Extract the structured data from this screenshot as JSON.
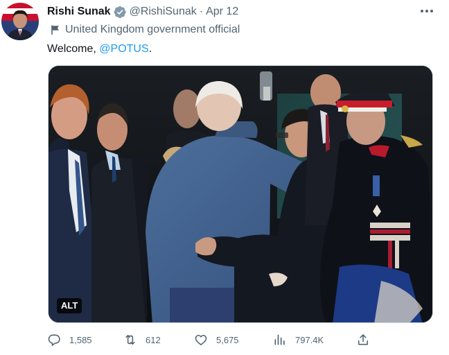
{
  "author": {
    "name": "Rishi Sunak",
    "handle": "@RishiSunak",
    "separator": "·",
    "date": "Apr 12",
    "affiliation": "United Kingdom government official"
  },
  "tweet": {
    "text_prefix": "Welcome, ",
    "mention": "@POTUS",
    "text_suffix": "."
  },
  "media": {
    "alt_label": "ALT"
  },
  "actions": {
    "replies": "1,585",
    "retweets": "612",
    "likes": "5,675",
    "views": "797.4K"
  },
  "icons": {
    "verified": "verified-badge-icon",
    "affiliation": "flag-icon",
    "reply": "reply-icon",
    "retweet": "retweet-icon",
    "like": "heart-icon",
    "views": "views-chart-icon",
    "share": "share-icon",
    "more": "more-dots-icon"
  },
  "colors": {
    "link": "#1d9bf0",
    "text": "#0f1419",
    "secondary": "#536471"
  }
}
